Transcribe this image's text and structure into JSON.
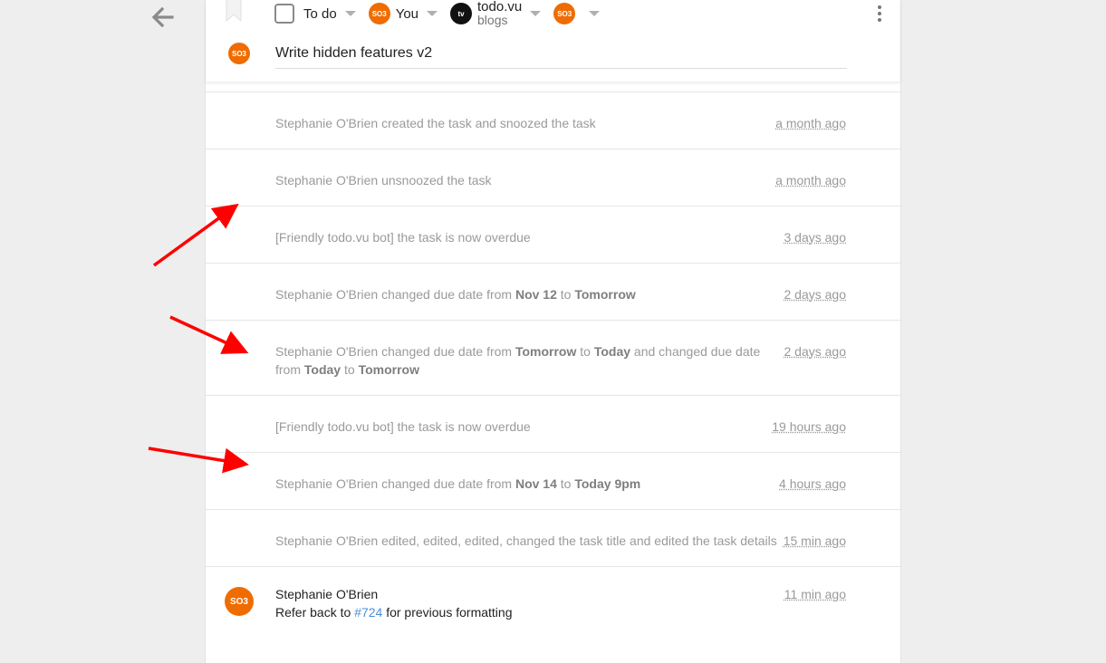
{
  "colors": {
    "accent": "#ef6c00",
    "annotation_arrow": "#ff0000",
    "link": "#4a90d9"
  },
  "header": {
    "status_label": "To do",
    "assignee_avatar": "SO3",
    "assignee_label": "You",
    "project_avatar": "tv",
    "project_name": "todo.vu",
    "project_sub": "blogs",
    "follower_avatar": "SO3",
    "title_avatar": "SO3",
    "title_value": "Write hidden features v2"
  },
  "activity": [
    {
      "text": "Stephanie O'Brien created the task and snoozed the task",
      "time": "a month ago"
    },
    {
      "text": "Stephanie O'Brien unsnoozed the task",
      "time": "a month ago"
    },
    {
      "text": "[Friendly todo.vu bot] the task is now overdue",
      "time": "3 days ago"
    },
    {
      "pre": "Stephanie O'Brien changed due date from ",
      "b1": "Nov 12",
      "mid": " to ",
      "b2": "Tomorrow",
      "time": "2 days ago"
    },
    {
      "pre": "Stephanie O'Brien changed due date from ",
      "b1": "Tomorrow",
      "mid": " to ",
      "b2": "Today",
      "mid2": " and changed due date from ",
      "b3": "Today",
      "mid3": " to ",
      "b4": "Tomorrow",
      "time": "2 days ago"
    },
    {
      "text": "[Friendly todo.vu bot] the task is now overdue",
      "time": "19 hours ago"
    },
    {
      "pre": "Stephanie O'Brien changed due date from ",
      "b1": "Nov 14",
      "mid": " to ",
      "b2": "Today 9pm",
      "time": "4 hours ago"
    },
    {
      "text": "Stephanie O'Brien edited, edited, edited, changed the task title and edited the task details",
      "time": "15 min ago"
    }
  ],
  "comment": {
    "avatar": "SO3",
    "author": "Stephanie O'Brien",
    "time": "11 min ago",
    "body_pre": "Refer back to ",
    "body_link": "#724",
    "body_post": " for previous formatting"
  }
}
